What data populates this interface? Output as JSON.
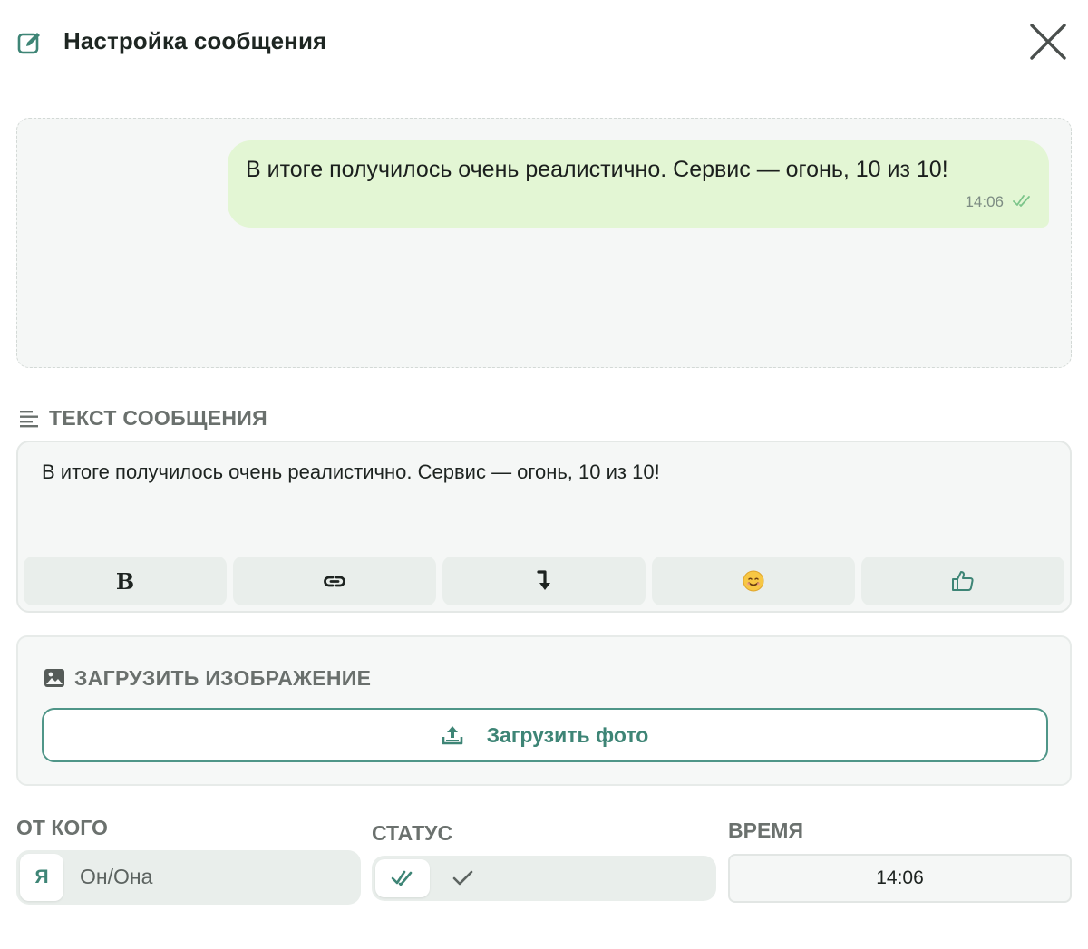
{
  "header": {
    "title": "Настройка сообщения",
    "edit_icon": "edit-icon",
    "close_icon": "close-icon"
  },
  "preview": {
    "message_text": "В итоге получилось очень реалистично. Сервис — огонь, 10 из 10!",
    "time": "14:06",
    "status_icon": "double-check-icon",
    "bubble_color": "#e3f6d4"
  },
  "message_section": {
    "label": "ТЕКСТ СООБЩЕНИЯ",
    "text": "В итоге получилось очень реалистично. Сервис — огонь, 10 из 10!",
    "toolbar": {
      "bold_label": "B",
      "buttons": [
        "bold",
        "link-icon",
        "line-break-icon",
        "emoji-icon",
        "thumbs-up-icon"
      ],
      "emoji": "😊"
    }
  },
  "upload_section": {
    "label": "ЗАГРУЗИТЬ ИЗОБРАЖЕНИЕ",
    "button_label": "Загрузить фото",
    "icon": "upload-icon"
  },
  "from_section": {
    "label": "ОТ КОГО",
    "options": [
      "Я",
      "Он/Она"
    ],
    "selected": "Я"
  },
  "status_section": {
    "label": "СТАТУС",
    "options": [
      "read",
      "sent"
    ],
    "selected": "read"
  },
  "time_section": {
    "label": "ВРЕМЯ",
    "value": "14:06"
  },
  "colors": {
    "accent": "#3e8576",
    "background_light": "#f5f7f6",
    "segment_bg": "#e9eeeb"
  }
}
